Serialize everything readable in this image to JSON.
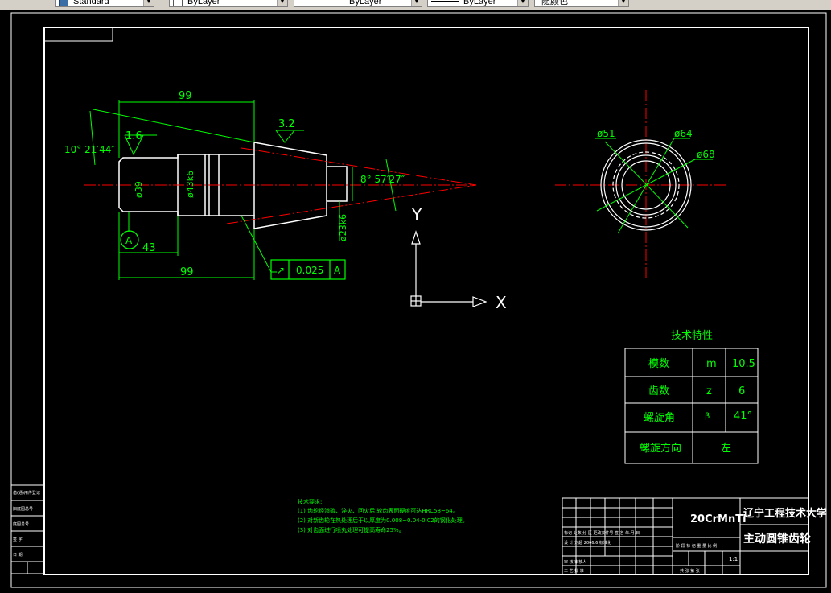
{
  "toolbar": {
    "style_value": "Standard",
    "layer_value": "ByLayer",
    "linetype_value": "ByLayer",
    "lineweight_value": "ByLayer",
    "color_value": "随颜色"
  },
  "drawing": {
    "dims": {
      "top_len": "99",
      "bottom_len": "99",
      "seg_len": "43",
      "taper_angle": "10° 21′44″",
      "cone_angle": "8° 57′27″",
      "rough_1": "1.6",
      "rough_2": "3.2",
      "dia_39": "ø39",
      "dia_43": "ø43k6",
      "dia_23": "ø23k6",
      "datum": "A",
      "tol_sym": "↗",
      "tol_val": "0.025",
      "tol_ref": "A"
    },
    "circle_dims": {
      "d1": "ø51",
      "d2": "ø64",
      "d3": "ø68"
    },
    "ucs": {
      "y": "Y",
      "x": "X"
    },
    "spec_table": {
      "title": "技术特性",
      "rows": [
        {
          "name": "模数",
          "sym": "m",
          "val": "10.5"
        },
        {
          "name": "齿数",
          "sym": "z",
          "val": "6"
        },
        {
          "name": "螺旋角",
          "sym": "β",
          "val": "41°"
        },
        {
          "name": "螺旋方向",
          "sym": "",
          "val": "左"
        }
      ]
    },
    "notes": {
      "title": "技术要求:",
      "lines": [
        "(1) 齿轮经渗碳、淬火、回火后,轮齿表面硬度可达HRC58~64。",
        "(2) 对新齿轮在热处理后于以厚度为0.008~0.04-0.02的钢化处理。",
        "(3) 对齿面进行喷丸处理可提高寿命25%。"
      ]
    },
    "title_block": {
      "material": "20CrMnTi",
      "school": "辽宁工程技术大学",
      "part_name": "主动圆锥齿轮",
      "scale": "1:1",
      "date": "2006.6",
      "col_labels": "标记 处数 分 区 更改文件号 签 名 年.月.日",
      "design_row": "设 计  刘超  2006.6  标准化",
      "stage_labels": "阶 段 标 记    重 量  比 例",
      "review_row": "审 核  审核人",
      "craft_row": "工 艺        批 准",
      "sheet_row": "共 张  第 张"
    },
    "side_block": [
      "借(通)用件登记",
      "旧底图总号",
      "底图总号",
      "签 字",
      "日 期"
    ]
  }
}
